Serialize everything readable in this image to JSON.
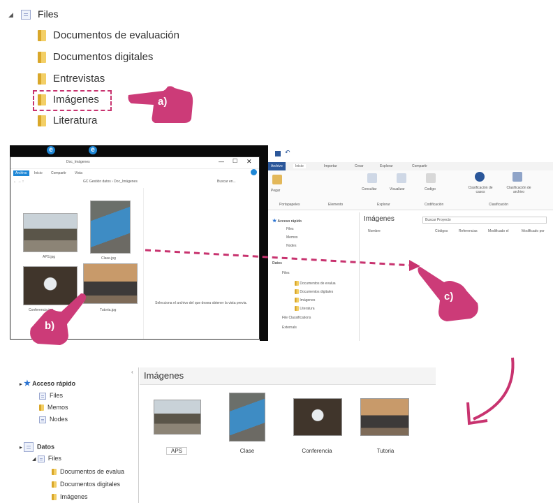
{
  "tree": {
    "root_label": "Files",
    "items": [
      "Documentos de evaluación",
      "Documentos digitales",
      "Entrevistas",
      "Imágenes",
      "Literatura"
    ]
  },
  "markers": {
    "a": "a)",
    "b": "b)",
    "c": "c)"
  },
  "explorer_left": {
    "title": "Doc_Imágenes",
    "tabs": [
      "Archivo",
      "Inicio",
      "Compartir",
      "Vista"
    ],
    "path": "GC Gestión datos › Doc_Imágenes",
    "search_placeholder": "Buscar en...",
    "files": [
      "APS.jpg",
      "Clase.jpg",
      "Conferencia.jpg",
      "Tutoria.jpg"
    ],
    "preview_text": "Selecciona el archivo del que desea obtener la vista previa."
  },
  "explorer_right": {
    "tabs": [
      "Archivo",
      "Inicio",
      "Importar",
      "Crear",
      "Explorar",
      "Compartir"
    ],
    "ribbon_buttons": [
      "Pegar",
      "Consultar",
      "Visualizar",
      "Codigo",
      "Clasificación de casos",
      "Clasificación de archivo"
    ],
    "ribbon_groups": [
      "Portapapeles",
      "Elemento",
      "Explorar",
      "Codificación",
      "Clasificación"
    ],
    "nav": [
      "Acceso rápido",
      "Files",
      "Memos",
      "Nodes",
      "Datos",
      "Files",
      "Documentos de evalua",
      "Documentos digitales",
      "Imágenes",
      "Literatura",
      "File Classifications",
      "Externals"
    ],
    "list_title": "Imágenes",
    "search_placeholder": "Buscar Proyecto",
    "columns": [
      "Nombre",
      "Códigos",
      "Referencias",
      "Modificado el",
      "Modificado por"
    ]
  },
  "bottom": {
    "nav": [
      "Acceso rápido",
      "Files",
      "Memos",
      "Nodes",
      "Datos",
      "Files",
      "Documentos de evalua",
      "Documentos digitales",
      "Imágenes"
    ],
    "title": "Imágenes",
    "items": [
      "APS",
      "Clase",
      "Conferencia",
      "Tutoria"
    ]
  },
  "colors": {
    "accent": "#c8336f",
    "folder": "#f3cf66",
    "nvivo_blue": "#2b579a",
    "win_blue": "#1e87d6"
  }
}
